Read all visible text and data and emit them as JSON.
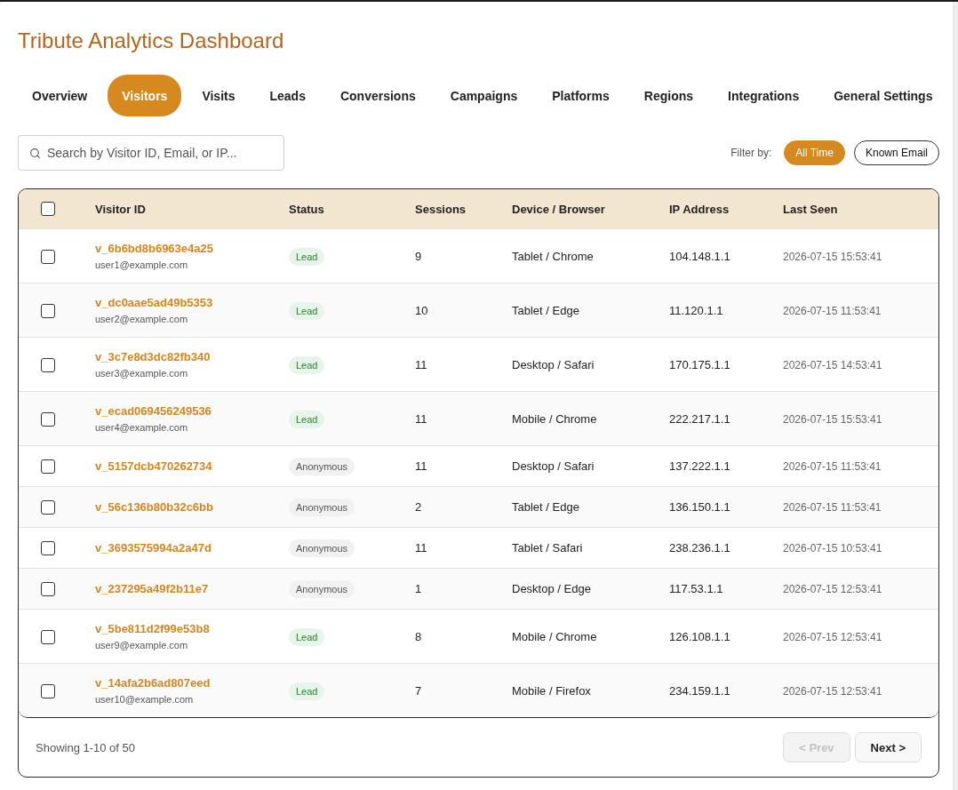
{
  "app": {
    "title": "Tribute Analytics Dashboard"
  },
  "tabs": [
    {
      "label": "Overview",
      "selected": false
    },
    {
      "label": "Visitors",
      "selected": true
    },
    {
      "label": "Visits",
      "selected": false
    },
    {
      "label": "Leads",
      "selected": false
    },
    {
      "label": "Conversions",
      "selected": false
    },
    {
      "label": "Campaigns",
      "selected": false
    },
    {
      "label": "Platforms",
      "selected": false
    },
    {
      "label": "Regions",
      "selected": false
    },
    {
      "label": "Integrations",
      "selected": false
    },
    {
      "label": "General Settings",
      "selected": false
    }
  ],
  "search": {
    "placeholder": "Search by Visitor ID, Email, or IP..."
  },
  "filter": {
    "label": "Filter by:",
    "options": [
      {
        "label": "All Time",
        "selected": true
      },
      {
        "label": "Known Email",
        "selected": false
      }
    ]
  },
  "table": {
    "select_all": {
      "checked": false
    },
    "columns": [
      "Visitor ID",
      "Status",
      "Sessions",
      "Device / Browser",
      "IP Address",
      "Last Seen"
    ],
    "rows": [
      {
        "checked": false,
        "visitor_id": "v_6b6bd8b6963e4a25",
        "email": "user1@example.com",
        "status": {
          "label": "Lead",
          "kind": "lead"
        },
        "sessions": "9",
        "device": "Tablet / Chrome",
        "ip": "104.148.1.1",
        "last_seen": "2026-07-15 15:53:41"
      },
      {
        "checked": false,
        "visitor_id": "v_dc0aae5ad49b5353",
        "email": "user2@example.com",
        "status": {
          "label": "Lead",
          "kind": "lead"
        },
        "sessions": "10",
        "device": "Tablet / Edge",
        "ip": "11.120.1.1",
        "last_seen": "2026-07-15 11:53:41"
      },
      {
        "checked": false,
        "visitor_id": "v_3c7e8d3dc82fb340",
        "email": "user3@example.com",
        "status": {
          "label": "Lead",
          "kind": "lead"
        },
        "sessions": "11",
        "device": "Desktop / Safari",
        "ip": "170.175.1.1",
        "last_seen": "2026-07-15 14:53:41"
      },
      {
        "checked": false,
        "visitor_id": "v_ecad069456249536",
        "email": "user4@example.com",
        "status": {
          "label": "Lead",
          "kind": "lead"
        },
        "sessions": "11",
        "device": "Mobile / Chrome",
        "ip": "222.217.1.1",
        "last_seen": "2026-07-15 15:53:41"
      },
      {
        "checked": false,
        "visitor_id": "v_5157dcb470262734",
        "status": {
          "label": "Anonymous",
          "kind": "anonymous"
        },
        "sessions": "11",
        "device": "Desktop / Safari",
        "ip": "137.222.1.1",
        "last_seen": "2026-07-15 11:53:41"
      },
      {
        "checked": false,
        "visitor_id": "v_56c136b80b32c6bb",
        "status": {
          "label": "Anonymous",
          "kind": "anonymous"
        },
        "sessions": "2",
        "device": "Tablet / Edge",
        "ip": "136.150.1.1",
        "last_seen": "2026-07-15 11:53:41"
      },
      {
        "checked": false,
        "visitor_id": "v_3693575994a2a47d",
        "status": {
          "label": "Anonymous",
          "kind": "anonymous"
        },
        "sessions": "11",
        "device": "Tablet / Safari",
        "ip": "238.236.1.1",
        "last_seen": "2026-07-15 10:53:41"
      },
      {
        "checked": false,
        "visitor_id": "v_237295a49f2b11e7",
        "status": {
          "label": "Anonymous",
          "kind": "anonymous"
        },
        "sessions": "1",
        "device": "Desktop / Edge",
        "ip": "117.53.1.1",
        "last_seen": "2026-07-15 12:53:41"
      },
      {
        "checked": false,
        "visitor_id": "v_5be811d2f99e53b8",
        "email": "user9@example.com",
        "status": {
          "label": "Lead",
          "kind": "lead"
        },
        "sessions": "8",
        "device": "Mobile / Chrome",
        "ip": "126.108.1.1",
        "last_seen": "2026-07-15 12:53:41"
      },
      {
        "checked": false,
        "visitor_id": "v_14afa2b6ad807eed",
        "email": "user10@example.com",
        "status": {
          "label": "Lead",
          "kind": "lead"
        },
        "sessions": "7",
        "device": "Mobile / Firefox",
        "ip": "234.159.1.1",
        "last_seen": "2026-07-15 12:53:41"
      }
    ]
  },
  "pagination": {
    "summary": "Showing 1-10 of 50",
    "prev": {
      "label": "< Prev",
      "disabled": true
    },
    "next": {
      "label": "Next >",
      "disabled": false
    }
  }
}
